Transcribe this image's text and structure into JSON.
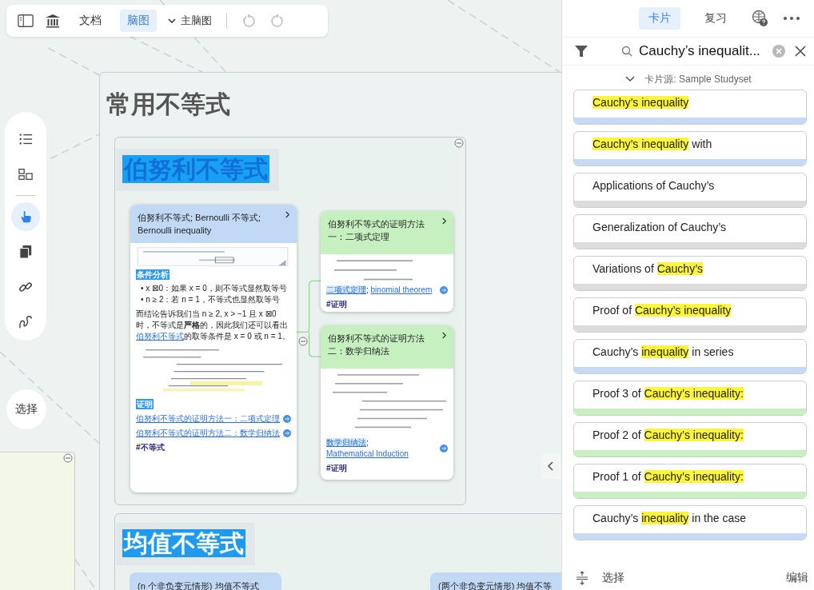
{
  "toolbar": {
    "tabs": [
      {
        "label": "文档",
        "selected": false
      },
      {
        "label": "脑图",
        "selected": true
      }
    ],
    "map_selector": "主脑图"
  },
  "side_tools": [
    {
      "kind": "outline",
      "selected": false
    },
    {
      "kind": "layout",
      "selected": false
    },
    {
      "kind": "hand",
      "selected": true
    },
    {
      "kind": "pages",
      "selected": false
    },
    {
      "kind": "link",
      "selected": false
    },
    {
      "kind": "curve",
      "selected": false
    }
  ],
  "select_button": "选择",
  "mind_map": {
    "title": "常用不等式",
    "groups": [
      {
        "heading": "伯努利不等式",
        "main_card": {
          "title": "伯努利不等式; Bernoulli 不等式; Bernoulli inequality",
          "section_1": "条件分析",
          "bullets": [
            "• x ⊠0：如果 x = 0，则不等式显然取等号",
            "• n ≥ 2：若 n = 1，不等式也显然取等号"
          ],
          "paragraph": {
            "before": "而结论告诉我们当 n ≥ 2, x > −1 且 x ⊠0 时，不等式是**严格**的，因此我们还可以看出",
            "link": "伯努利不等式",
            "after": "的取等条件是 x = 0 或 n = 1。"
          },
          "section_2": "证明",
          "links": [
            "伯努利不等式的证明方法一：二项式定理",
            "伯努利不等式的证明方法二：数学归纳法"
          ],
          "tag": "#不等式"
        },
        "child_cards": [
          {
            "title": "伯努利不等式的证明方法一：二项式定理",
            "term": "二项式定理",
            "separator": ";",
            "link": "binomial theorem",
            "tag": "#证明"
          },
          {
            "title": "伯努利不等式的证明方法二：数学归纳法",
            "term": "数学归纳法",
            "separator": ";",
            "link": "Mathematical Induction",
            "tag": "#证明"
          }
        ]
      },
      {
        "heading": "均值不等式",
        "cards": [
          "(n 个非负变元情形) 均值不等式",
          "(两个非负变元情形) 均值不等"
        ]
      }
    ]
  },
  "panel": {
    "tabs": [
      {
        "label": "卡片",
        "selected": true
      },
      {
        "label": "复习",
        "selected": false
      }
    ],
    "search": {
      "value": "Cauchy’s inequalit..."
    },
    "source": "卡片源: Sample Studyset",
    "cards": [
      {
        "color": "#c6daf6",
        "parts": [
          {
            "text": "Cauchy’s inequality",
            "highlight": true
          }
        ]
      },
      {
        "color": "#c6daf6",
        "parts": [
          {
            "text": "Cauchy’s inequality",
            "highlight": true
          },
          {
            "text": " with",
            "highlight": false
          }
        ]
      },
      {
        "color": "#dcdcdc",
        "parts": [
          {
            "text": "Applications of Cauchy’s",
            "highlight": false
          }
        ]
      },
      {
        "color": "#dcdcdc",
        "parts": [
          {
            "text": "Generalization of Cauchy’s",
            "highlight": false
          }
        ]
      },
      {
        "color": "#dcdcdc",
        "parts": [
          {
            "text": "Variations of ",
            "highlight": false
          },
          {
            "text": "Cauchy’s",
            "highlight": true
          }
        ]
      },
      {
        "color": "#dcdcdc",
        "parts": [
          {
            "text": "Proof of ",
            "highlight": false
          },
          {
            "text": "Cauchy’s inequality",
            "highlight": true
          }
        ]
      },
      {
        "color": "#c6daf6",
        "parts": [
          {
            "text": "Cauchy’s ",
            "highlight": false
          },
          {
            "text": "inequality",
            "highlight": true
          },
          {
            "text": " in series",
            "highlight": false
          }
        ]
      },
      {
        "color": "#c8f0c0",
        "parts": [
          {
            "text": "Proof 3 of ",
            "highlight": false
          },
          {
            "text": "Cauchy’s inequality:",
            "highlight": true
          }
        ]
      },
      {
        "color": "#c8f0c0",
        "parts": [
          {
            "text": "Proof 2 of ",
            "highlight": false
          },
          {
            "text": "Cauchy’s inequality:",
            "highlight": true
          }
        ]
      },
      {
        "color": "#c8f0c0",
        "parts": [
          {
            "text": "Proof 1 of ",
            "highlight": false
          },
          {
            "text": "Cauchy’s inequality:",
            "highlight": true
          }
        ]
      },
      {
        "color": "#c6daf6",
        "parts": [
          {
            "text": "Cauchy’s ",
            "highlight": false
          },
          {
            "text": "inequality",
            "highlight": true
          },
          {
            "text": " in the case",
            "highlight": false
          }
        ]
      }
    ],
    "footer": {
      "select": "选择",
      "edit": "编辑"
    }
  }
}
